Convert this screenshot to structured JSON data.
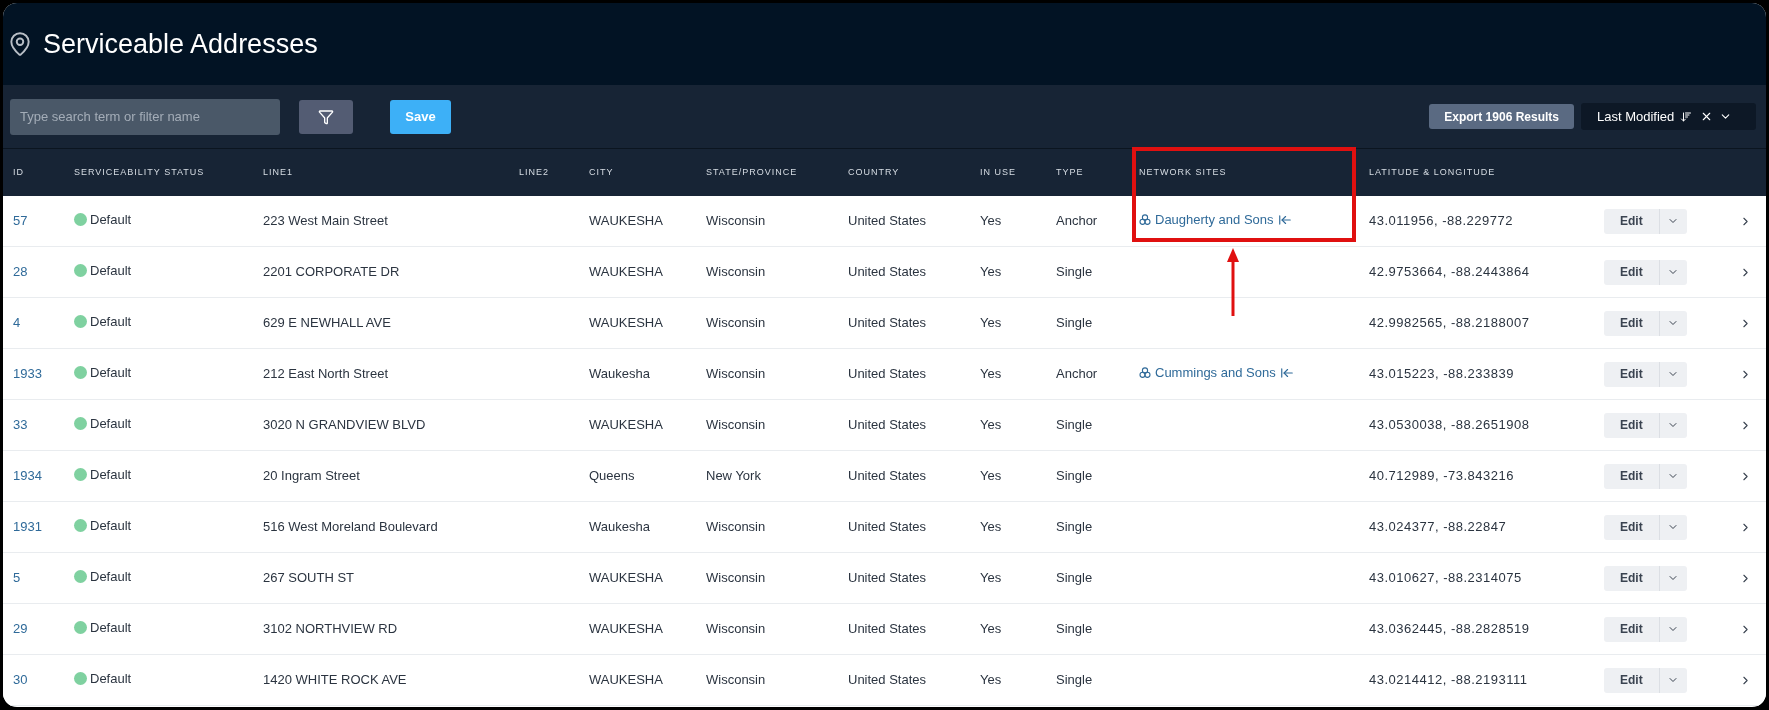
{
  "page": {
    "title": "Serviceable Addresses"
  },
  "toolbar": {
    "search": {
      "placeholder": "Type search term or filter name"
    },
    "save_label": "Save",
    "export_label": "Export 1906 Results",
    "sort": {
      "label": "Last Modified"
    }
  },
  "table": {
    "columns": [
      "ID",
      "SERVICEABILITY STATUS",
      "LINE1",
      "LINE2",
      "CITY",
      "STATE/PROVINCE",
      "COUNTRY",
      "IN USE",
      "TYPE",
      "NETWORK SITES",
      "LATITUDE & LONGITUDE"
    ],
    "rows": [
      {
        "id": "57",
        "status": {
          "label": "Default",
          "color": "#7fd1a0"
        },
        "line1": "223 West Main Street",
        "city": "WAUKESHA",
        "state": "Wisconsin",
        "country": "United States",
        "in_use": "Yes",
        "type": "Anchor",
        "network_site": "Daugherty and Sons",
        "lat_lng": "43.011956, -88.229772",
        "edit": "Edit"
      },
      {
        "id": "28",
        "status": {
          "label": "Default",
          "color": "#7fd1a0"
        },
        "line1": "2201 CORPORATE DR",
        "city": "WAUKESHA",
        "state": "Wisconsin",
        "country": "United States",
        "in_use": "Yes",
        "type": "Single",
        "lat_lng": "42.9753664, -88.2443864",
        "edit": "Edit"
      },
      {
        "id": "4",
        "status": {
          "label": "Default",
          "color": "#7fd1a0"
        },
        "line1": "629 E NEWHALL AVE",
        "city": "WAUKESHA",
        "state": "Wisconsin",
        "country": "United States",
        "in_use": "Yes",
        "type": "Single",
        "lat_lng": "42.9982565, -88.2188007",
        "edit": "Edit"
      },
      {
        "id": "1933",
        "status": {
          "label": "Default",
          "color": "#7fd1a0"
        },
        "line1": "212 East North Street",
        "city": "Waukesha",
        "state": "Wisconsin",
        "country": "United States",
        "in_use": "Yes",
        "type": "Anchor",
        "network_site": "Cummings and Sons",
        "lat_lng": "43.015223, -88.233839",
        "edit": "Edit"
      },
      {
        "id": "33",
        "status": {
          "label": "Default",
          "color": "#7fd1a0"
        },
        "line1": "3020 N GRANDVIEW BLVD",
        "city": "WAUKESHA",
        "state": "Wisconsin",
        "country": "United States",
        "in_use": "Yes",
        "type": "Single",
        "lat_lng": "43.0530038, -88.2651908",
        "edit": "Edit"
      },
      {
        "id": "1934",
        "status": {
          "label": "Default",
          "color": "#7fd1a0"
        },
        "line1": "20 Ingram Street",
        "city": "Queens",
        "state": "New York",
        "country": "United States",
        "in_use": "Yes",
        "type": "Single",
        "lat_lng": "40.712989, -73.843216",
        "edit": "Edit"
      },
      {
        "id": "1931",
        "status": {
          "label": "Default",
          "color": "#7fd1a0"
        },
        "line1": "516 West Moreland Boulevard",
        "city": "Waukesha",
        "state": "Wisconsin",
        "country": "United States",
        "in_use": "Yes",
        "type": "Single",
        "lat_lng": "43.024377, -88.22847",
        "edit": "Edit"
      },
      {
        "id": "5",
        "status": {
          "label": "Default",
          "color": "#7fd1a0"
        },
        "line1": "267 SOUTH ST",
        "city": "WAUKESHA",
        "state": "Wisconsin",
        "country": "United States",
        "in_use": "Yes",
        "type": "Single",
        "lat_lng": "43.010627, -88.2314075",
        "edit": "Edit"
      },
      {
        "id": "29",
        "status": {
          "label": "Default",
          "color": "#7fd1a0"
        },
        "line1": "3102 NORTHVIEW RD",
        "city": "WAUKESHA",
        "state": "Wisconsin",
        "country": "United States",
        "in_use": "Yes",
        "type": "Single",
        "lat_lng": "43.0362445, -88.2828519",
        "edit": "Edit"
      },
      {
        "id": "30",
        "status": {
          "label": "Default",
          "color": "#7fd1a0"
        },
        "line1": "1420 WHITE ROCK AVE",
        "city": "WAUKESHA",
        "state": "Wisconsin",
        "country": "United States",
        "in_use": "Yes",
        "type": "Single",
        "lat_lng": "43.0214412, -88.2193111",
        "edit": "Edit"
      }
    ]
  }
}
